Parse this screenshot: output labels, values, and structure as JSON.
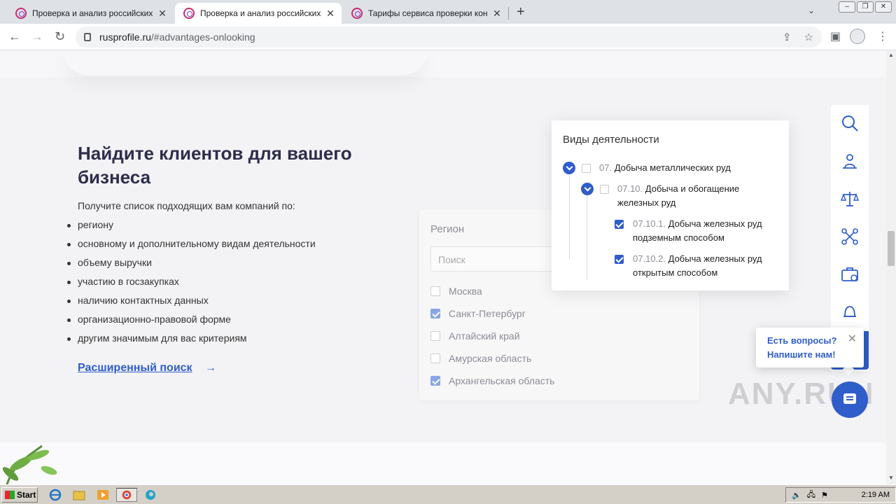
{
  "browser": {
    "tabs": [
      {
        "title": "Проверка и анализ российских юр",
        "active": false
      },
      {
        "title": "Проверка и анализ российских юр",
        "active": true
      },
      {
        "title": "Тарифы сервиса проверки контра",
        "active": false
      }
    ],
    "url_domain": "rusprofile.ru",
    "url_path": "/#advantages-onlooking"
  },
  "main": {
    "heading": "Найдите клиентов для вашего бизнеса",
    "lead": "Получите список подходящих вам компаний по:",
    "criteria": [
      "региону",
      "основному и дополнительному видам деятельности",
      "объему выручки",
      "участию в госзакупках",
      "наличию контактных данных",
      "организационно-правовой форме",
      "другим значимым для вас критериям"
    ],
    "advanced_search": "Расширенный поиск",
    "advanced_arrow": "→"
  },
  "region_card": {
    "title": "Регион",
    "search_placeholder": "Поиск",
    "items": [
      {
        "label": "Москва",
        "checked": false
      },
      {
        "label": "Санкт-Петербург",
        "checked": true
      },
      {
        "label": "Алтайский край",
        "checked": false
      },
      {
        "label": "Амурская область",
        "checked": false
      },
      {
        "label": "Архангельская область",
        "checked": true
      }
    ]
  },
  "activity_card": {
    "title": "Виды деятельности",
    "items": [
      {
        "code": "07.",
        "label": "Добыча металлических руд",
        "checked": false,
        "label_line2": ""
      },
      {
        "code": "07.10.",
        "label": "Добыча и обогащение",
        "label_line2": "железных руд",
        "checked": false
      },
      {
        "code": "07.10.1.",
        "label": "Добыча железных руд",
        "label_line2": "подземным способом",
        "checked": true
      },
      {
        "code": "07.10.2.",
        "label": "Добыча железных руд",
        "label_line2": "открытым способом",
        "checked": true
      }
    ]
  },
  "side_panel": {
    "icons": [
      "search-icon",
      "businessman-icon",
      "scales-icon",
      "network-icon",
      "briefcase-icon",
      "bell-icon"
    ]
  },
  "chat": {
    "line1": "Есть вопросы?",
    "line2": "Напишите нам!",
    "close": "✕"
  },
  "watermark": "ANY.RUN",
  "taskbar": {
    "start": "Start",
    "clock": "2:19 AM"
  },
  "colors": {
    "accent": "#2f5dc9",
    "heading": "#2d2d4b",
    "muted": "#8c8c96"
  }
}
